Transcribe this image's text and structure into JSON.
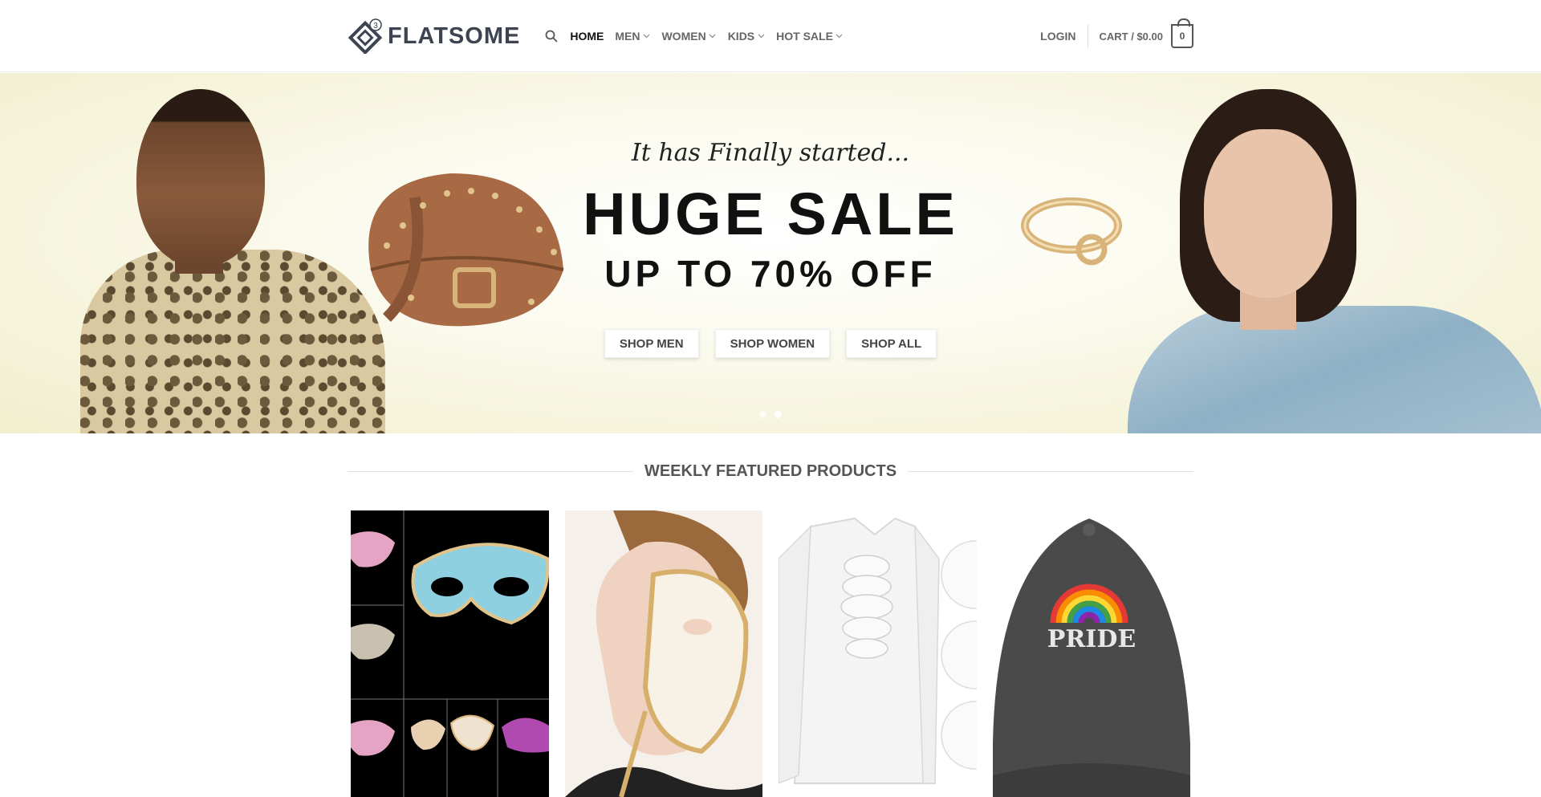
{
  "header": {
    "logo_text": "FLATSOME",
    "logo_badge": "3",
    "nav": [
      {
        "label": "HOME",
        "active": true,
        "dropdown": false
      },
      {
        "label": "MEN",
        "active": false,
        "dropdown": true
      },
      {
        "label": "WOMEN",
        "active": false,
        "dropdown": true
      },
      {
        "label": "KIDS",
        "active": false,
        "dropdown": true
      },
      {
        "label": "HOT SALE",
        "active": false,
        "dropdown": true
      }
    ],
    "login_label": "LOGIN",
    "cart_label": "CART / $0.00",
    "cart_count": "0"
  },
  "hero": {
    "tagline": "It has Finally started...",
    "headline": "HUGE SALE",
    "subheadline": "UP TO 70% OFF",
    "buttons": [
      "SHOP MEN",
      "SHOP WOMEN",
      "SHOP ALL"
    ],
    "slide_count": 2,
    "active_slide": 2
  },
  "featured": {
    "title": "WEEKLY FEATURED PRODUCTS",
    "products": [
      {
        "image": "masquerade-masks-collage"
      },
      {
        "image": "woman-with-white-gold-mask"
      },
      {
        "image": "white-ruffled-blouse"
      },
      {
        "image": "pride-rainbow-cap"
      }
    ]
  },
  "colors": {
    "text_dark": "#111111",
    "nav_text": "#666666",
    "logo_text": "#3d4451",
    "hero_bg": "#f6f4db"
  }
}
